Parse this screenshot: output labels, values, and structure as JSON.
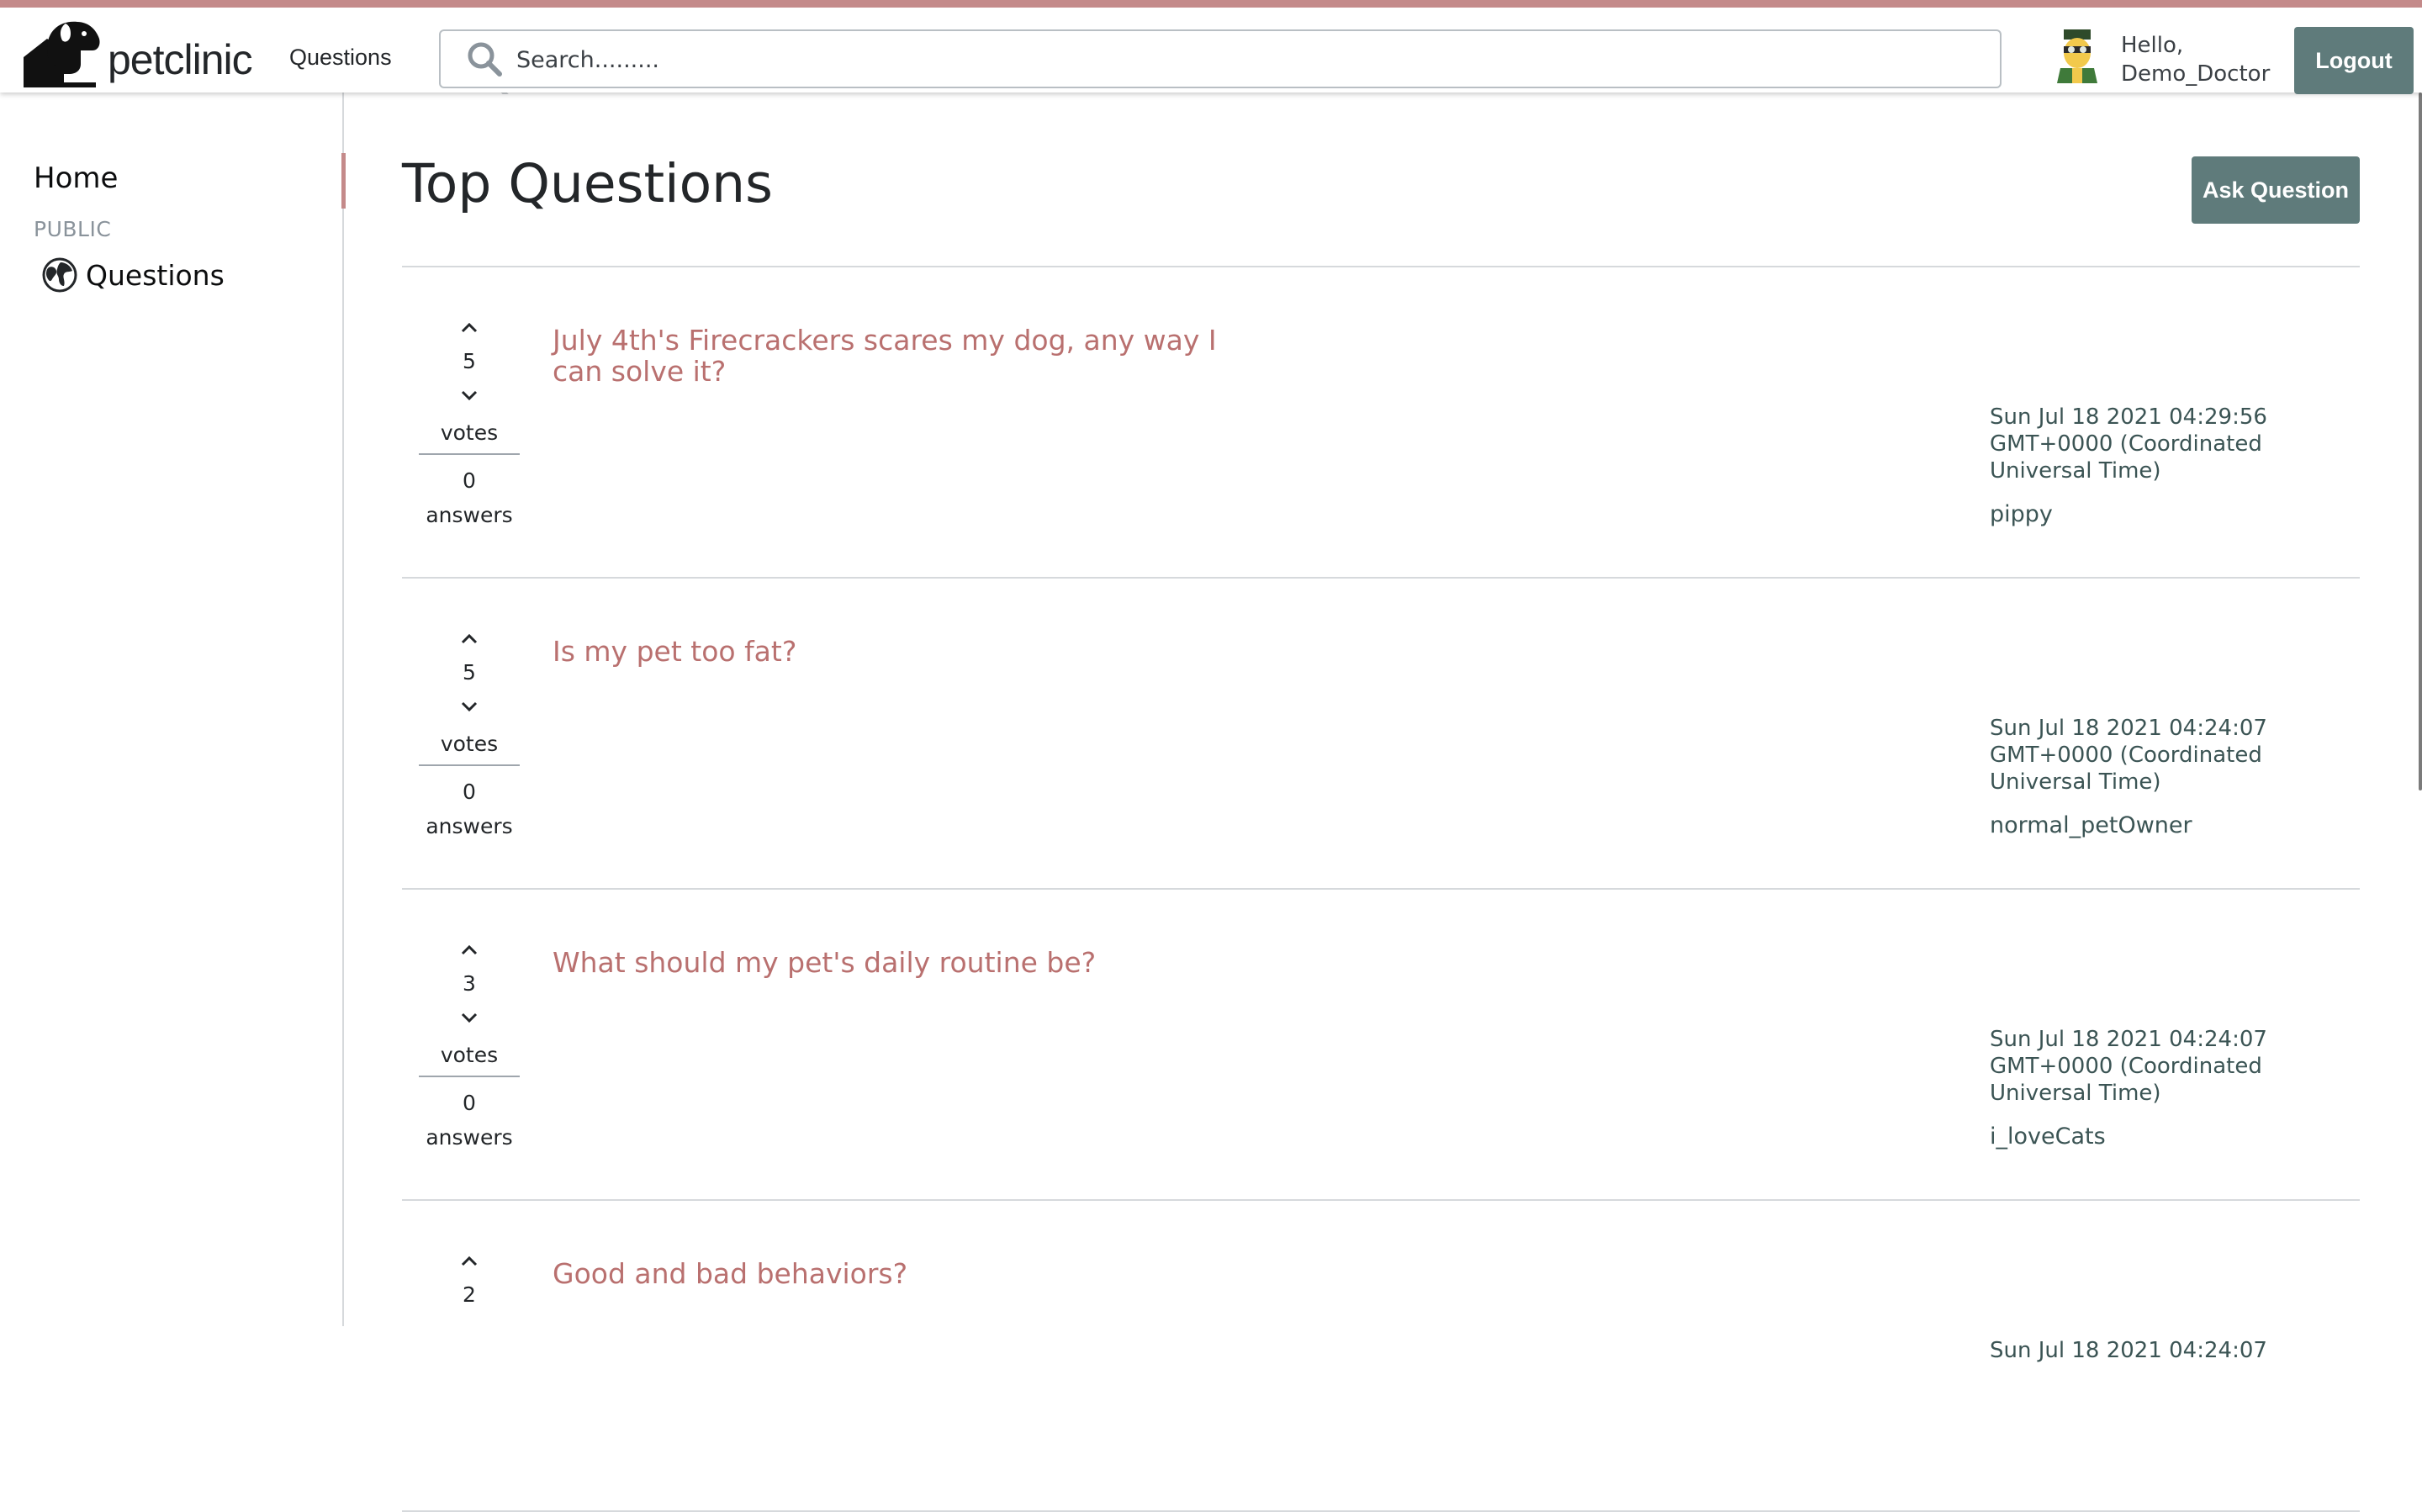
{
  "header": {
    "logo_text": "petclinic",
    "nav_questions": "Questions",
    "search_placeholder": "Search.........",
    "greeting": "Hello,",
    "username": "Demo_Doctor",
    "logout_label": "Logout",
    "accent_color": "#c48a8a",
    "button_color": "#5f7b7b"
  },
  "sidebar": {
    "home_label": "Home",
    "section_label": "PUBLIC",
    "questions_label": "Questions"
  },
  "main": {
    "title": "Top Questions",
    "ask_button_label": "Ask Question",
    "votes_label": "votes",
    "answers_label": "answers",
    "questions": [
      {
        "title": "July 4th's Firecrackers scares my dog, any way I can solve it?",
        "votes": "5",
        "answers": "0",
        "date": "Sun Jul 18 2021 04:29:56 GMT+0000 (Coordinated Universal Time)",
        "author": "pippy"
      },
      {
        "title": "Is my pet too fat?",
        "votes": "5",
        "answers": "0",
        "date": "Sun Jul 18 2021 04:24:07 GMT+0000 (Coordinated Universal Time)",
        "author": "normal_petOwner"
      },
      {
        "title": "What should my pet's daily routine be?",
        "votes": "3",
        "answers": "0",
        "date": "Sun Jul 18 2021 04:24:07 GMT+0000 (Coordinated Universal Time)",
        "author": "i_loveCats"
      },
      {
        "title": "Good and bad behaviors?",
        "votes": "2",
        "answers": "",
        "date": "Sun Jul 18 2021 04:24:07",
        "author": ""
      }
    ]
  }
}
